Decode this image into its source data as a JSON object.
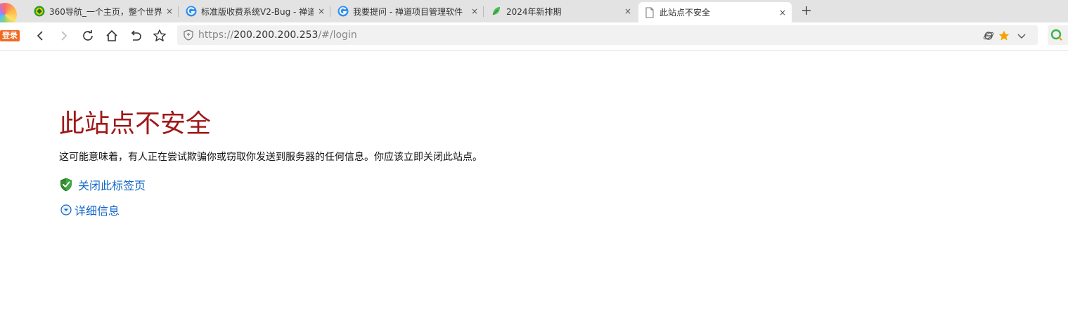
{
  "browser": {
    "tabs": [
      {
        "title": "360导航_一个主页，整个世界",
        "favicon": "360-nav-icon"
      },
      {
        "title": "标准版收费系统V2-Bug - 禅道",
        "favicon": "zentao-icon"
      },
      {
        "title": "我要提问 - 禅道项目管理软件",
        "favicon": "zentao-icon"
      },
      {
        "title": "2024年新排期",
        "favicon": "leaf-icon"
      },
      {
        "title": "此站点不安全",
        "favicon": "page-icon",
        "active": true
      }
    ],
    "close_glyph": "×",
    "new_tab_label": "+",
    "login_badge": "登录",
    "url": {
      "scheme": "https://",
      "host": "200.200.200.253",
      "path": "/#/login"
    },
    "accent_star": "#f5a300"
  },
  "warning": {
    "title": "此站点不安全",
    "description": "这可能意味着，有人正在尝试欺骗你或窃取你发送到服务器的任何信息。你应该立即关闭此站点。",
    "close_tab_label": "关闭此标签页",
    "details_label": "详细信息",
    "title_color": "#a01818",
    "link_color": "#1267c7"
  }
}
